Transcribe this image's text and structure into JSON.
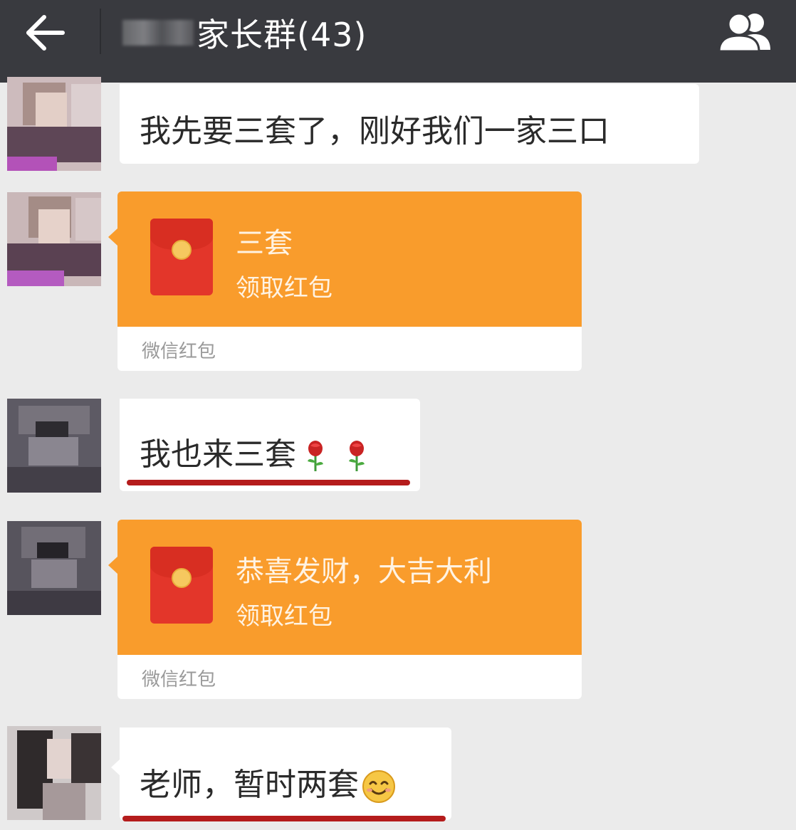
{
  "header": {
    "title": "家长群(43)",
    "background": "#393a3f",
    "back_icon": "arrow-left-icon",
    "members_icon": "group-members-icon"
  },
  "messages": [
    {
      "type": "text",
      "text": "我先要三套了，刚好我们一家三口"
    },
    {
      "type": "red_packet",
      "title": "三套",
      "action": "领取红包",
      "brand": "微信红包"
    },
    {
      "type": "text",
      "text": "我也来三套",
      "emoji": [
        "rose-icon",
        "rose-icon"
      ],
      "underlined": true
    },
    {
      "type": "red_packet",
      "title": "恭喜发财，大吉大利",
      "action": "领取红包",
      "brand": "微信红包"
    },
    {
      "type": "text",
      "text": "老师，暂时两套",
      "emoji": [
        "smile-icon"
      ],
      "underlined": true
    }
  ],
  "colors": {
    "chat_background": "#ebebeb",
    "red_packet_orange": "#f99c2c",
    "envelope_red": "#e3362a",
    "underline_red": "#b51c1c"
  }
}
